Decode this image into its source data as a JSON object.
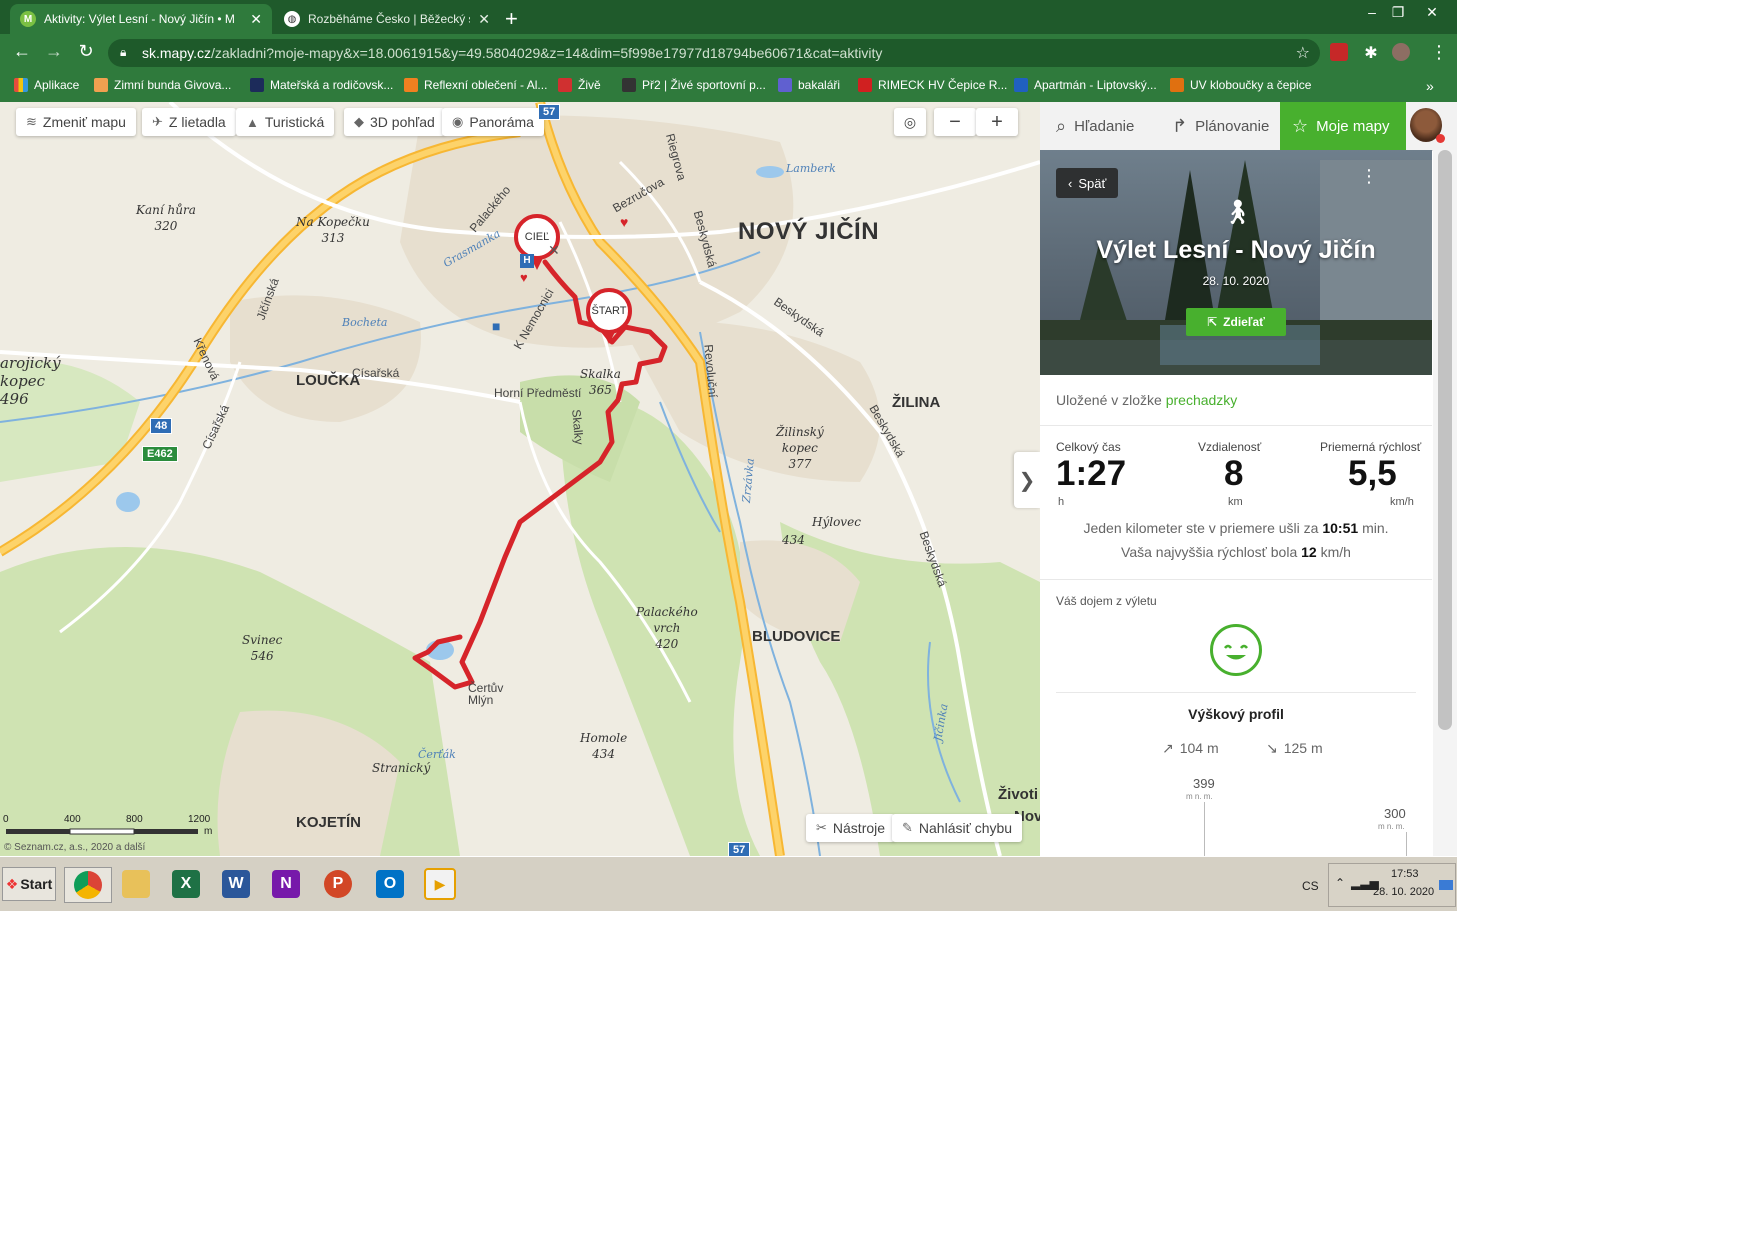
{
  "browser": {
    "tabs": [
      {
        "title": "Aktivity: Výlet Lesní - Nový Jičín • M",
        "favicon": "M",
        "active": true
      },
      {
        "title": "Rozběháme Česko | Běžecký svět |",
        "favicon": "globe",
        "active": false
      }
    ],
    "new_tab": "+",
    "window_controls": {
      "minimize": "–",
      "restore": "❐",
      "close": "✕"
    },
    "nav": {
      "back": "←",
      "forward": "→",
      "reload": "↻"
    },
    "url_host": "sk.mapy.cz",
    "url_path": "/zakladni?moje-mapy&x=18.0061915&y=49.5804029&z=14&dim=5f998e17977d18794be60671&cat=aktivity",
    "bookmarks": [
      {
        "label": "Aplikace",
        "color": "#e0a000"
      },
      {
        "label": "Zimní bunda Givova...",
        "color": "#f0a050"
      },
      {
        "label": "Mateřská a rodičovsk...",
        "color": "#1c2b5a"
      },
      {
        "label": "Reflexní oblečení - Al...",
        "color": "#f08020"
      },
      {
        "label": "Živě",
        "color": "#d03030"
      },
      {
        "label": "Př2 | Živé sportovní p...",
        "color": "#333333"
      },
      {
        "label": "bakaláři",
        "color": "#6060d0"
      },
      {
        "label": "RIMECK HV Čepice R...",
        "color": "#d02020"
      },
      {
        "label": "Apartmán - Liptovský...",
        "color": "#2060c0"
      },
      {
        "label": "UV kloboučky a čepice",
        "color": "#e07010"
      }
    ],
    "bookmarks_more": "»"
  },
  "map": {
    "controls": {
      "change_map": "Zmeniť mapu",
      "aerial": "Z lietadla",
      "tourist": "Turistická",
      "view3d": "3D pohľad",
      "panorama": "Panoráma",
      "zoom_out": "−",
      "zoom_in": "+"
    },
    "towns": {
      "novy_jicin": "NOVÝ JIČÍN",
      "loucka": "LOUČKA",
      "zilina": "ŽILINA",
      "bludovice": "BLUDOVICE",
      "kojetin": "KOJETÍN",
      "zivotice": "Životi",
      "zivotice2": "Nov"
    },
    "hills": {
      "kani_hura": "Kaní hůra",
      "kani_hura_h": "320",
      "na_kopecku": "Na Kopečku",
      "na_kopecku_h": "313",
      "arojicky": "arojický",
      "arojicky2": "kopec",
      "arojicky_h": "496",
      "skalka": "Skalka",
      "skalka_h": "365",
      "zilinsky": "Žilinský",
      "zilinsky2": "kopec",
      "zilinsky_h": "377",
      "hylovec": "Hýlovec",
      "hylovec_h": "434",
      "palackeho": "Palackého",
      "palackeho2": "vrch",
      "palackeho_h": "420",
      "svinec": "Svinec",
      "svinec_h": "546",
      "homole": "Homole",
      "homole_h": "434",
      "strancky": "Stranický"
    },
    "streets": {
      "palackeho": "Palackého",
      "bezrucova": "Bezručova",
      "riegrova": "Riegrova",
      "beskydska": "Beskydská",
      "beskydska2": "Beskydská",
      "beskydska3": "Beskydská",
      "beskydska4": "Beskydská",
      "jicinska": "Jičínská",
      "k_nemocnici": "K Nemocnici",
      "krenova": "Křenová",
      "cisarska": "Císařská",
      "cisarska2": "Císařská",
      "revolucni": "Revoluční",
      "skalky": "Skalky",
      "horni_predmesti": "Horní Předměstí",
      "certuv_mlyn": "Čertův",
      "certuv_mlyn2": "Mlýn"
    },
    "waters": {
      "grasmanka": "Grasmanka",
      "bocheta": "Bocheta",
      "lamberk": "Lamberk",
      "zrzavka": "Zrzávka",
      "certak": "Čerťák",
      "jicinka": "Jičinka"
    },
    "road_signs": {
      "r57_top": "57",
      "r57_bottom": "57",
      "r48": "48",
      "e462": "E462"
    },
    "pins": {
      "finish": "CIEĽ",
      "start": "ŠTART"
    },
    "scale": {
      "s0": "0",
      "s400": "400",
      "s800": "800",
      "s1200": "1200",
      "unit": "m"
    },
    "copyright": "© Seznam.cz, a.s., 2020 a další",
    "tools": "Nástroje",
    "report": "Nahlásiť chybu",
    "collapse": "❯"
  },
  "panel": {
    "tabs": {
      "search": "Hľadanie",
      "plan": "Plánovanie",
      "mymaps": "Moje mapy"
    },
    "back": "Späť",
    "title": "Výlet Lesní - Nový Jičín",
    "date": "28. 10. 2020",
    "share": "Zdieľať",
    "saved_prefix": "Uložené v zložke",
    "saved_folder": "prechadzky",
    "stats": {
      "time_label": "Celkový čas",
      "time_value": "1:27",
      "time_unit": "h",
      "distance_label": "Vzdialenosť",
      "distance_value": "8",
      "distance_unit": "km",
      "speed_label": "Priemerná rýchlosť",
      "speed_value": "5,5",
      "speed_unit": "km/h"
    },
    "pace_prefix": "Jeden kilometer ste v priemere ušli za",
    "pace_value": "10:51",
    "pace_suffix": "min.",
    "maxspeed_prefix": "Vaša najvyššia rýchlosť bola",
    "maxspeed_value": "12",
    "maxspeed_suffix": "km/h",
    "impression_label": "Váš dojem z výletu",
    "elevation_title": "Výškový profil",
    "ascent": "104 m",
    "descent": "125 m",
    "elev_max": "399",
    "elev_max_unit": "m n. m.",
    "elev_mid": "300",
    "elev_mid_unit": "m n. m."
  },
  "taskbar": {
    "start": "Start",
    "apps": [
      "chrome",
      "explorer",
      "excel",
      "word",
      "onenote",
      "powerpoint",
      "outlook",
      "media"
    ],
    "lang": "CS",
    "time": "17:53",
    "date": "28. 10. 2020"
  },
  "colors": {
    "chrome_dark": "#1f5a2b",
    "chrome": "#2f7a3c",
    "route": "#d6242a",
    "accent_green": "#48b02e"
  }
}
